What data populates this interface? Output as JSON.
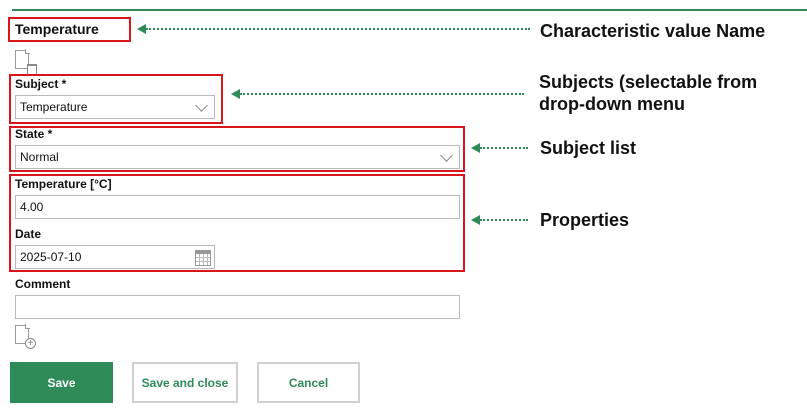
{
  "header": {
    "title": "Temperature"
  },
  "form": {
    "subject": {
      "label": "Subject *",
      "value": "Temperature"
    },
    "state": {
      "label": "State *",
      "value": "Normal"
    },
    "temperature": {
      "label": "Temperature [°C]",
      "value": "4.00"
    },
    "date": {
      "label": "Date",
      "value": "2025-07-10"
    },
    "comment": {
      "label": "Comment",
      "value": ""
    }
  },
  "buttons": {
    "save": "Save",
    "save_close": "Save and close",
    "cancel": "Cancel"
  },
  "annotations": {
    "name": "Characteristic value Name",
    "subjects_line1": "Subjects (selectable from",
    "subjects_line2": "drop-down menu",
    "subject_list": "Subject list",
    "properties": "Properties"
  },
  "icons": {
    "delete": "document-delete-icon",
    "add": "document-add-icon",
    "dropdown": "chevron-down-icon",
    "calendar": "calendar-icon"
  },
  "colors": {
    "accent": "#2e8b57",
    "highlight": "#d9141b"
  }
}
